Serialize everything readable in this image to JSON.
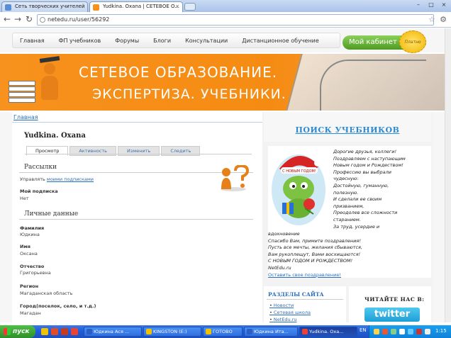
{
  "browser": {
    "tabs": [
      {
        "title": "Сеть творческих учителей",
        "close": "×"
      },
      {
        "title": "Yudkina. Oxana | СЕТЕВОЕ О...",
        "close": "×"
      }
    ],
    "url": "netedu.ru/user/56292",
    "back": "←",
    "forward": "→",
    "reload": "↻",
    "star": "☆",
    "wrench": "🔧",
    "minimize": "–",
    "maximize": "□",
    "close": "×"
  },
  "site_nav": {
    "items": [
      "Главная",
      "ФП учебников",
      "Форумы",
      "Блоги",
      "Консультации",
      "Дистанционное обучение"
    ],
    "cabinet": "Мой кабинет",
    "seal": "Платно"
  },
  "banner": {
    "line1": "СЕТЕВОЕ ОБРАЗОВАНИЕ.",
    "line2": "ЭКСПЕРТИЗА. УЧЕБНИКИ."
  },
  "breadcrumb": "Главная",
  "user": {
    "name": "Yudkina. Oxana",
    "tabs": [
      "Просмотр",
      "Активность",
      "Изменить",
      "Следить"
    ]
  },
  "subscriptions": {
    "title": "Рассылки",
    "manage_prefix": "Управлять",
    "manage_link": "моими подписками",
    "my_label": "Мой подписка",
    "my_value": "Нет"
  },
  "personal": {
    "title": "Личные данные",
    "fields": [
      {
        "label": "Фамилия",
        "value": "Юдкина"
      },
      {
        "label": "Имя",
        "value": "Оксана"
      },
      {
        "label": "Отчество",
        "value": "Григорьевна"
      },
      {
        "label": "Регион",
        "value": "Магаданская область"
      },
      {
        "label": "Город(поселок, село, и т.д.)",
        "value": "Магадан"
      }
    ]
  },
  "right": {
    "search_title": "ПОИСК УЧЕБНИКОВ",
    "ny_card_label": "С НОВЫМ ГОДОМ!",
    "ny_lines": [
      "Дорогие друзья, коллеги!",
      "Поздравляем с наступающим",
      "Новым годом и Рождеством!",
      "Профессию вы выбрали",
      "чудесную:",
      "Достойную, гуманную,",
      "полезную.",
      "И сделали ее своим",
      "призванием,",
      "Преодолев все сложности",
      "старанием.",
      "За труд, усердие и"
    ],
    "ny_bottom": [
      "вдохновение",
      "Спасибо Вам, примите поздравления!",
      "Пусть все мечты, желания сбываются,",
      "Вам рукоплещут, Вами восхищаются!",
      "С НОВЫМ ГОДОМ И РОЖДЕСТВОМ!",
      "NetEdu.ru"
    ],
    "ny_link": "Оставить свое поздравление!",
    "sections_title": "РАЗДЕЛЫ САЙТА",
    "sections": [
      "Новости",
      "Сетевая школа",
      "NetEdu.ru"
    ],
    "read_title": "ЧИТАЙТЕ НАС В:",
    "twitter": "twitter"
  },
  "taskbar": {
    "start": "пуск",
    "buttons": [
      "Юдкина Ася ...",
      "KINGSTON (E:)",
      "ГОТОВО",
      "Юдкина Ита...",
      "Yudkina. Oxa..."
    ],
    "lang": "EN",
    "clock": "1:15"
  },
  "colors": {
    "accent_orange": "#f7921e",
    "link_blue": "#2a6ebb",
    "cabinet_green": "#5aa52a"
  }
}
